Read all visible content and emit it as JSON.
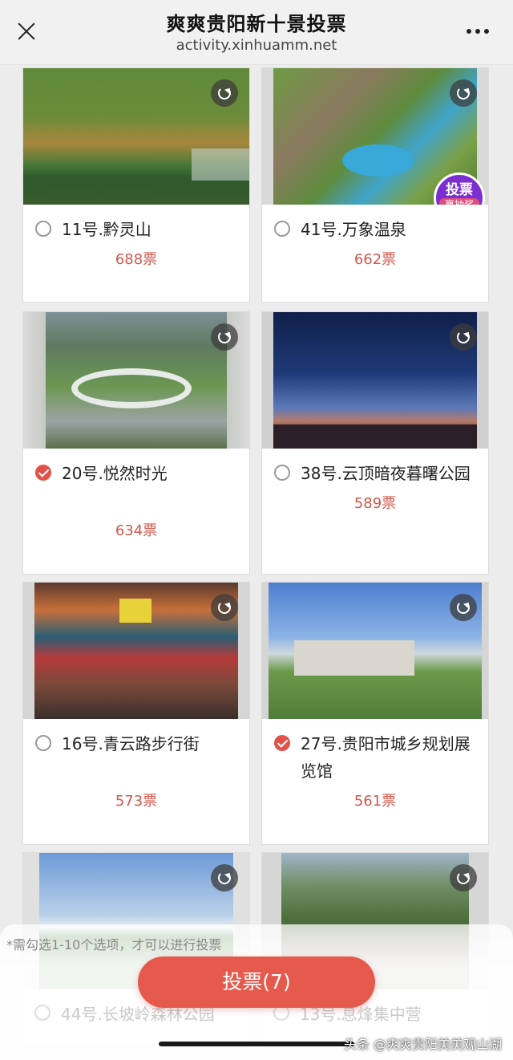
{
  "header": {
    "title": "爽爽贵阳新十景投票",
    "url": "activity.xinhuamm.net"
  },
  "cards": [
    {
      "name": "11号.黔灵山",
      "votes": "688票",
      "checked": false
    },
    {
      "name": "41号.万象温泉",
      "votes": "662票",
      "checked": false,
      "badge_line1": "投票",
      "badge_line2": "赢抽奖"
    },
    {
      "name": "20号.悦然时光",
      "votes": "634票",
      "checked": true
    },
    {
      "name": "38号.云顶暗夜暮曙公园",
      "votes": "589票",
      "checked": false
    },
    {
      "name": "16号.青云路步行街",
      "votes": "573票",
      "checked": false
    },
    {
      "name": "27号.贵阳市城乡规划展览馆",
      "votes": "561票",
      "checked": true
    },
    {
      "name": "44号.长坡岭森林公园",
      "votes": "",
      "checked": false
    },
    {
      "name": "13号.息烽集中营",
      "votes": "",
      "checked": false
    }
  ],
  "footer": {
    "hint": "*需勾选1-10个选项，才可以进行投票",
    "vote_button": "投票(7)",
    "watermark": "头条 @爽爽贵阳美美观山湖"
  },
  "colors": {
    "accent": "#e55a4c",
    "vote_text": "#d0584c",
    "badge": "#7a2fd0"
  }
}
